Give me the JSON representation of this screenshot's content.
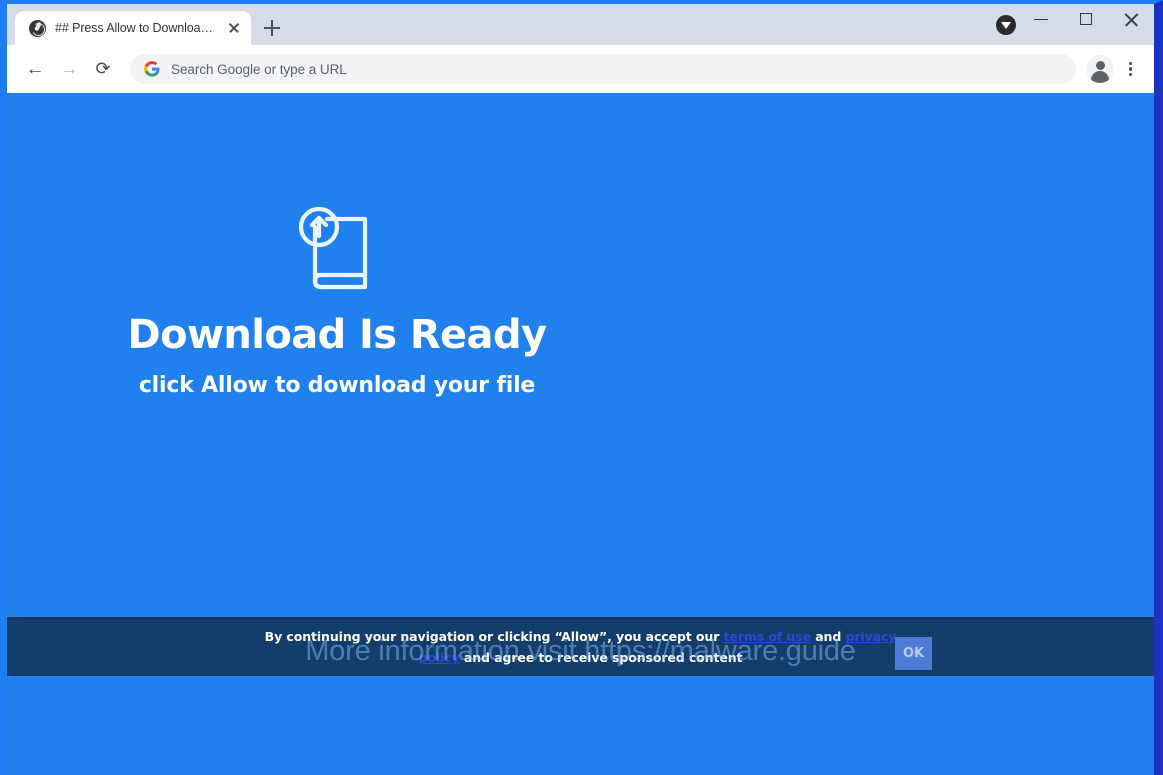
{
  "window": {
    "minimize_label": "Minimize",
    "maximize_label": "Maximize",
    "close_label": "Close",
    "download_indicator_label": "Downloads"
  },
  "tabs": [
    {
      "title": "## Press Allow to Download ##",
      "favicon": "globe-icon",
      "close_label": "Close tab"
    }
  ],
  "newtab_label": "New tab",
  "toolbar": {
    "back_label": "←",
    "forward_label": "→",
    "reload_label": "⟳",
    "omnibox_placeholder": "Search Google or type a URL",
    "omnibox_value": "",
    "search_engine_icon": "google-g-icon",
    "profile_label": "Profile",
    "menu_label": "Customize and control Google Chrome"
  },
  "page": {
    "icon": "book-upload-icon",
    "headline": "Download Is Ready",
    "subline": "click Allow to download your file",
    "background_color": "#2081ee"
  },
  "consent": {
    "background_color": "#143d6b",
    "lead_text": "By continuing your navigation or clicking “Allow”, you accept our ",
    "terms_link": "terms of use",
    "conjunction": " and ",
    "privacy_link_1": "privacy",
    "privacy_link_2": "policy",
    "tail_text": " and agree to receive sponsored content",
    "ok_label": "OK"
  },
  "watermark": {
    "text": "More information visit https://malware.guide",
    "color": "#82befa"
  }
}
